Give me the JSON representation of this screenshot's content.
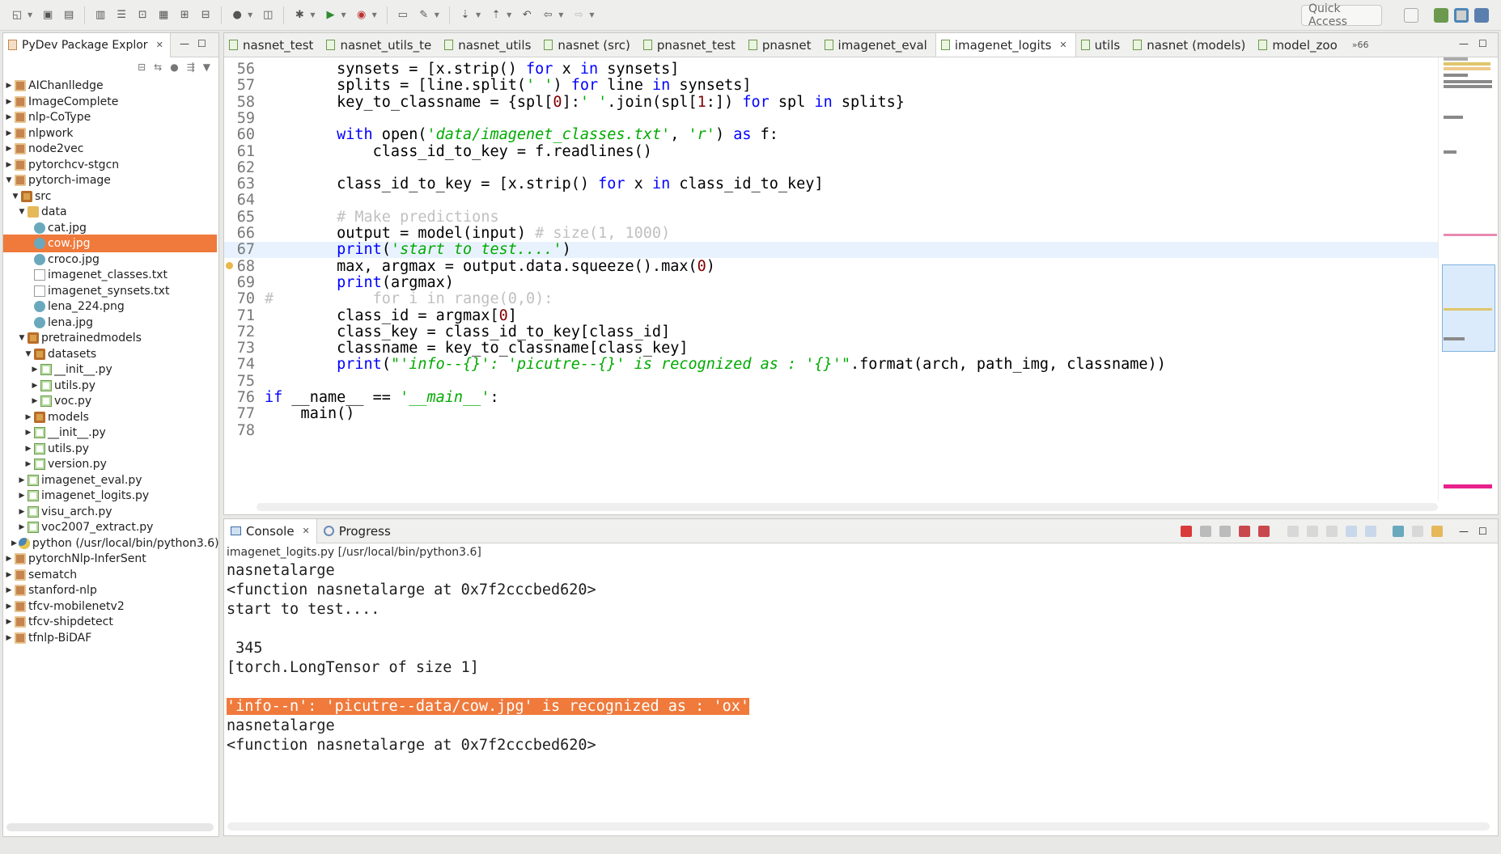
{
  "toolbar": {
    "quick_access": "Quick Access"
  },
  "explorer": {
    "title": "PyDev Package Explor",
    "items": [
      {
        "label": "AIChanlledge",
        "level": 0,
        "expanded": false,
        "icon": "project-icon"
      },
      {
        "label": "ImageComplete",
        "level": 0,
        "expanded": false,
        "icon": "project-icon"
      },
      {
        "label": "nlp-CoType",
        "level": 0,
        "expanded": false,
        "icon": "project-icon"
      },
      {
        "label": "nlpwork",
        "level": 0,
        "expanded": false,
        "icon": "project-icon"
      },
      {
        "label": "node2vec",
        "level": 0,
        "expanded": false,
        "icon": "project-icon"
      },
      {
        "label": "pytorchcv-stgcn",
        "level": 0,
        "expanded": false,
        "icon": "project-icon"
      },
      {
        "label": "pytorch-image",
        "level": 0,
        "expanded": true,
        "icon": "project-icon"
      },
      {
        "label": "src",
        "level": 1,
        "expanded": true,
        "icon": "source-folder-icon"
      },
      {
        "label": "data",
        "level": 2,
        "expanded": true,
        "icon": "folder-icon"
      },
      {
        "label": "cat.jpg",
        "level": 3,
        "expanded": null,
        "icon": "image-file-icon"
      },
      {
        "label": "cow.jpg",
        "level": 3,
        "expanded": null,
        "icon": "image-file-icon",
        "selected": true
      },
      {
        "label": "croco.jpg",
        "level": 3,
        "expanded": null,
        "icon": "image-file-icon"
      },
      {
        "label": "imagenet_classes.txt",
        "level": 3,
        "expanded": null,
        "icon": "text-file-icon"
      },
      {
        "label": "imagenet_synsets.txt",
        "level": 3,
        "expanded": null,
        "icon": "text-file-icon"
      },
      {
        "label": "lena_224.png",
        "level": 3,
        "expanded": null,
        "icon": "image-file-icon"
      },
      {
        "label": "lena.jpg",
        "level": 3,
        "expanded": null,
        "icon": "image-file-icon"
      },
      {
        "label": "pretrainedmodels",
        "level": 2,
        "expanded": true,
        "icon": "package-icon"
      },
      {
        "label": "datasets",
        "level": 3,
        "expanded": true,
        "icon": "package-icon"
      },
      {
        "label": "__init__.py",
        "level": 4,
        "expanded": false,
        "icon": "python-file-icon"
      },
      {
        "label": "utils.py",
        "level": 4,
        "expanded": false,
        "icon": "python-file-icon"
      },
      {
        "label": "voc.py",
        "level": 4,
        "expanded": false,
        "icon": "python-file-icon"
      },
      {
        "label": "models",
        "level": 3,
        "expanded": false,
        "icon": "package-icon"
      },
      {
        "label": "__init__.py",
        "level": 3,
        "expanded": false,
        "icon": "python-file-icon"
      },
      {
        "label": "utils.py",
        "level": 3,
        "expanded": false,
        "icon": "python-file-icon"
      },
      {
        "label": "version.py",
        "level": 3,
        "expanded": false,
        "icon": "python-file-icon"
      },
      {
        "label": "imagenet_eval.py",
        "level": 2,
        "expanded": false,
        "icon": "python-file-icon"
      },
      {
        "label": "imagenet_logits.py",
        "level": 2,
        "expanded": false,
        "icon": "python-file-icon"
      },
      {
        "label": "visu_arch.py",
        "level": 2,
        "expanded": false,
        "icon": "python-file-icon"
      },
      {
        "label": "voc2007_extract.py",
        "level": 2,
        "expanded": false,
        "icon": "python-file-icon"
      },
      {
        "label": "python  (/usr/local/bin/python3.6)",
        "level": 1,
        "expanded": false,
        "icon": "python-interpreter-icon"
      },
      {
        "label": "pytorchNlp-InferSent",
        "level": 0,
        "expanded": false,
        "icon": "project-icon"
      },
      {
        "label": "sematch",
        "level": 0,
        "expanded": false,
        "icon": "project-icon"
      },
      {
        "label": "stanford-nlp",
        "level": 0,
        "expanded": false,
        "icon": "project-icon"
      },
      {
        "label": "tfcv-mobilenetv2",
        "level": 0,
        "expanded": false,
        "icon": "project-icon"
      },
      {
        "label": "tfcv-shipdetect",
        "level": 0,
        "expanded": false,
        "icon": "project-icon"
      },
      {
        "label": "tfnlp-BiDAF",
        "level": 0,
        "expanded": false,
        "icon": "project-icon"
      }
    ]
  },
  "editor": {
    "tabs": [
      {
        "label": "nasnet_test",
        "active": false
      },
      {
        "label": "nasnet_utils_te",
        "active": false
      },
      {
        "label": "nasnet_utils",
        "active": false
      },
      {
        "label": "nasnet (src)",
        "active": false
      },
      {
        "label": "pnasnet_test",
        "active": false
      },
      {
        "label": "pnasnet",
        "active": false
      },
      {
        "label": "imagenet_eval",
        "active": false
      },
      {
        "label": "imagenet_logits",
        "active": true
      },
      {
        "label": "utils",
        "active": false
      },
      {
        "label": "nasnet (models)",
        "active": false
      },
      {
        "label": "model_zoo",
        "active": false
      }
    ],
    "overflow_count": "»66",
    "current_line": 67,
    "warning_line": 68,
    "lines": [
      {
        "n": "56",
        "html": "        synsets = [x.strip() <span class='kw'>for</span> x <span class='kw'>in</span> synsets]"
      },
      {
        "n": "57",
        "html": "        splits = [line.split(<span class='st'>' '</span>) <span class='kw'>for</span> line <span class='kw'>in</span> synsets]"
      },
      {
        "n": "58",
        "html": "        key_to_classname = {spl[<span class='num'>0</span>]:<span class='st'>' '</span>.join(spl[<span class='num'>1</span>:]) <span class='kw'>for</span> spl <span class='kw'>in</span> splits}"
      },
      {
        "n": "59",
        "html": ""
      },
      {
        "n": "60",
        "html": "        <span class='kw'>with</span> open(<span class='st'>'data/imagenet_classes.txt'</span>, <span class='st'>'r'</span>) <span class='kw'>as</span> f:"
      },
      {
        "n": "61",
        "html": "            class_id_to_key = f.readlines()"
      },
      {
        "n": "62",
        "html": ""
      },
      {
        "n": "63",
        "html": "        class_id_to_key = [x.strip() <span class='kw'>for</span> x <span class='kw'>in</span> class_id_to_key]"
      },
      {
        "n": "64",
        "html": ""
      },
      {
        "n": "65",
        "html": "        <span class='cm'># Make predictions</span>"
      },
      {
        "n": "66",
        "html": "        output = model(input) <span class='cm'># size(1, 1000)</span>"
      },
      {
        "n": "67",
        "html": "        <span class='kw'>print</span>(<span class='st'>'start to test....'</span>)"
      },
      {
        "n": "68",
        "html": "        max, argmax = output.data.squeeze().max(<span class='num'>0</span>)"
      },
      {
        "n": "69",
        "html": "        <span class='kw'>print</span>(argmax)"
      },
      {
        "n": "70",
        "html": "<span class='cm'>#           for i in range(0,0):</span>"
      },
      {
        "n": "71",
        "html": "        class_id = argmax[<span class='num'>0</span>]"
      },
      {
        "n": "72",
        "html": "        class_key = class_id_to_key[class_id]"
      },
      {
        "n": "73",
        "html": "        classname = key_to_classname[class_key]"
      },
      {
        "n": "74",
        "html": "        <span class='kw'>print</span>(<span class='st'>\"'info--{}': 'picutre--{}' is recognized as : '{}'\"</span>.format(arch, path_img, classname))"
      },
      {
        "n": "75",
        "html": ""
      },
      {
        "n": "76",
        "html": "<span class='kw'>if</span> __name__ == <span class='st'>'__main__'</span>:"
      },
      {
        "n": "77",
        "html": "    main()"
      },
      {
        "n": "78",
        "html": ""
      }
    ]
  },
  "console": {
    "tabs": [
      {
        "label": "Console",
        "active": true
      },
      {
        "label": "Progress",
        "active": false
      }
    ],
    "path": "imagenet_logits.py [/usr/local/bin/python3.6]",
    "lines": [
      {
        "text": "nasnetalarge",
        "highlight": false
      },
      {
        "text": "<function nasnetalarge at 0x7f2cccbed620>",
        "highlight": false
      },
      {
        "text": "start to test....",
        "highlight": false
      },
      {
        "text": "",
        "highlight": false
      },
      {
        "text": " 345",
        "highlight": false
      },
      {
        "text": "[torch.LongTensor of size 1]",
        "highlight": false
      },
      {
        "text": "",
        "highlight": false
      },
      {
        "text": "'info--n': 'picutre--data/cow.jpg' is recognized as : 'ox'",
        "highlight": true
      },
      {
        "text": "nasnetalarge",
        "highlight": false
      },
      {
        "text": "<function nasnetalarge at 0x7f2cccbed620>",
        "highlight": false
      }
    ]
  }
}
